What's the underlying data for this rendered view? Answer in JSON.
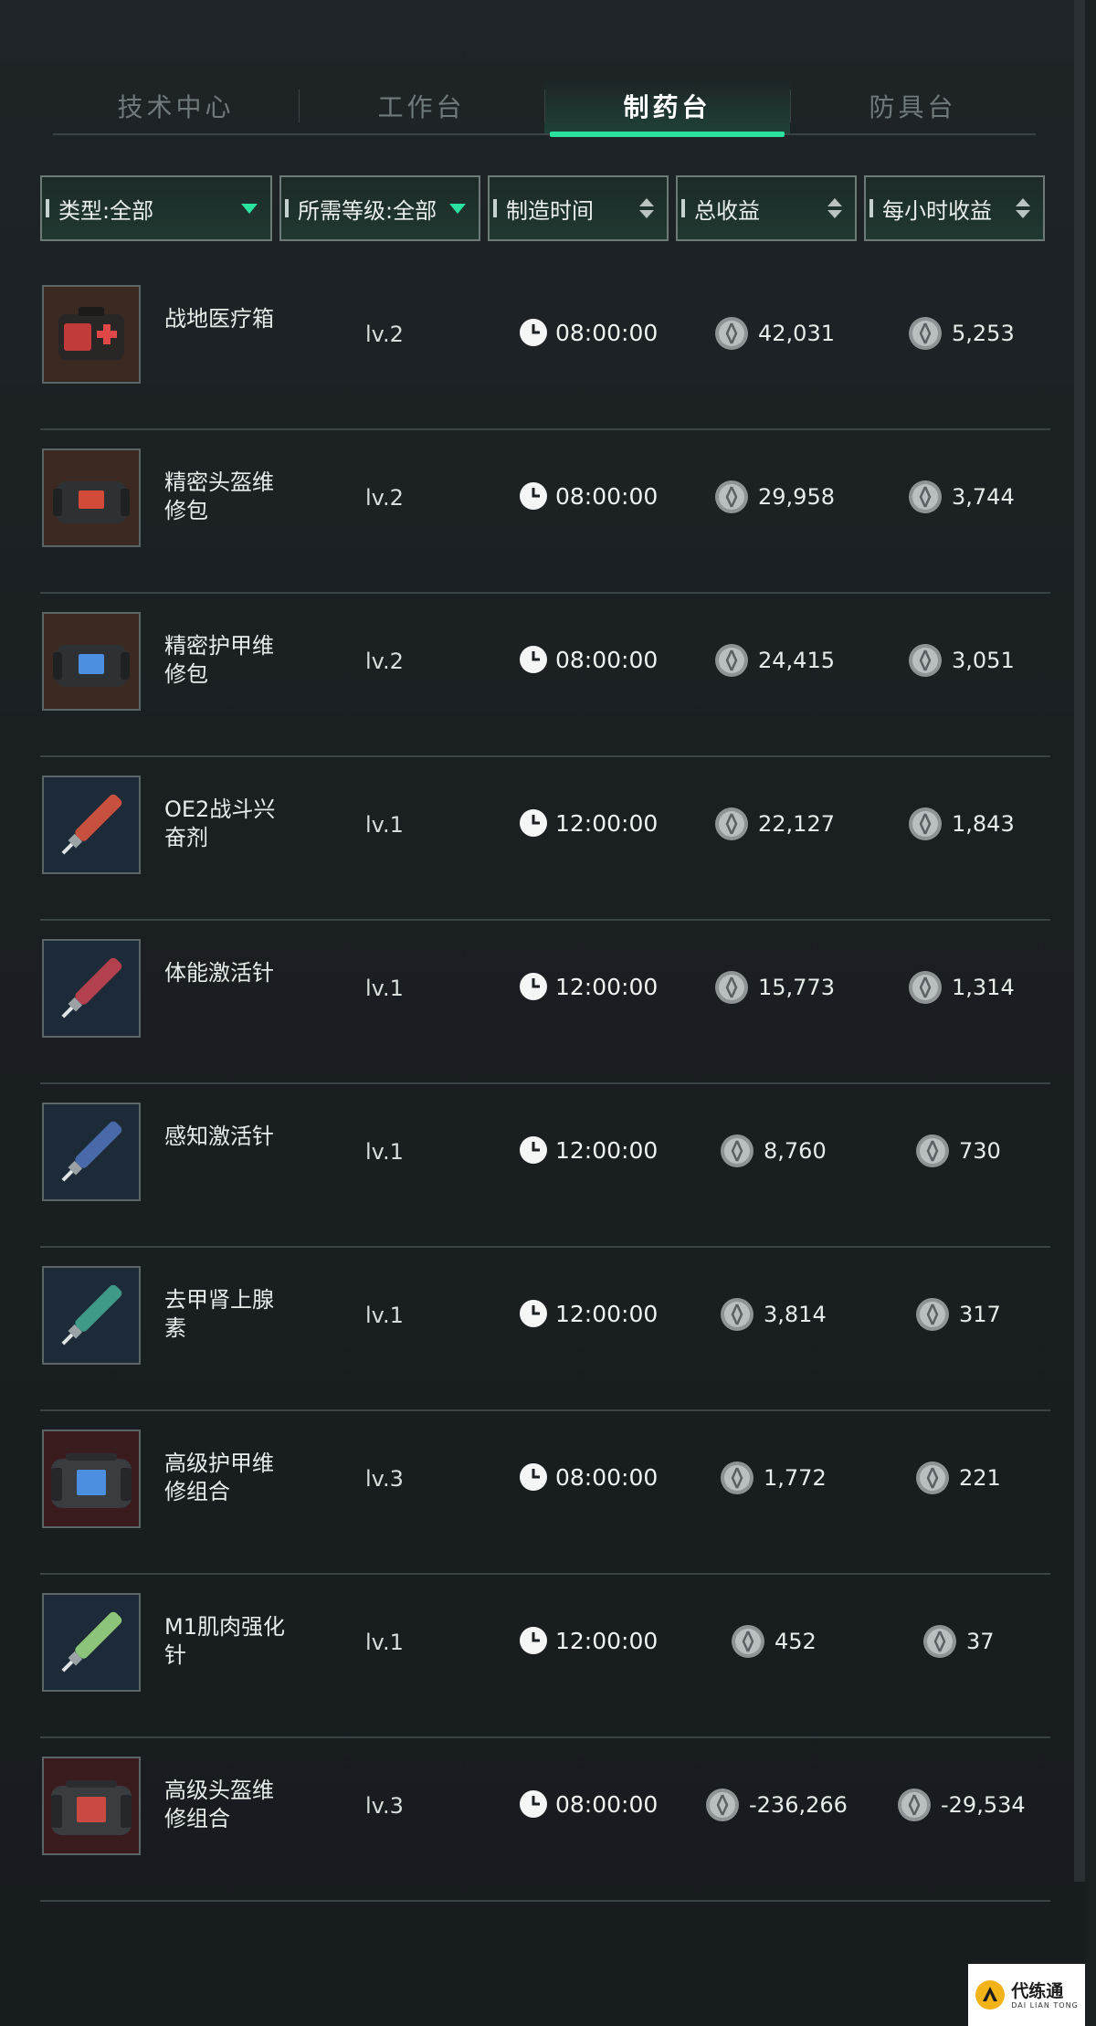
{
  "tabs": [
    {
      "label": "技术中心",
      "active": false
    },
    {
      "label": "工作台",
      "active": false
    },
    {
      "label": "制药台",
      "active": true
    },
    {
      "label": "防具台",
      "active": false
    }
  ],
  "filters": {
    "type": "类型:全部",
    "level": "所需等级:全部",
    "craft_time": "制造时间",
    "total_income": "总收益",
    "hourly_income": "每小时收益"
  },
  "items": [
    {
      "name": "战地医疗箱",
      "level": "lv.2",
      "time": "08:00:00",
      "total": "42,031",
      "hourly": "5,253",
      "icon": "medkit-icon"
    },
    {
      "name": "精密头盔维修包",
      "level": "lv.2",
      "time": "08:00:00",
      "total": "29,958",
      "hourly": "3,744",
      "icon": "repair-kit-icon"
    },
    {
      "name": "精密护甲维修包",
      "level": "lv.2",
      "time": "08:00:00",
      "total": "24,415",
      "hourly": "3,051",
      "icon": "repair-kit-icon"
    },
    {
      "name": "OE2战斗兴奋剂",
      "level": "lv.1",
      "time": "12:00:00",
      "total": "22,127",
      "hourly": "1,843",
      "icon": "injector-icon"
    },
    {
      "name": "体能激活针",
      "level": "lv.1",
      "time": "12:00:00",
      "total": "15,773",
      "hourly": "1,314",
      "icon": "injector-icon"
    },
    {
      "name": "感知激活针",
      "level": "lv.1",
      "time": "12:00:00",
      "total": "8,760",
      "hourly": "730",
      "icon": "injector-icon"
    },
    {
      "name": "去甲肾上腺素",
      "level": "lv.1",
      "time": "12:00:00",
      "total": "3,814",
      "hourly": "317",
      "icon": "injector-icon"
    },
    {
      "name": "高级护甲维修组合",
      "level": "lv.3",
      "time": "08:00:00",
      "total": "1,772",
      "hourly": "221",
      "icon": "repair-combo-icon"
    },
    {
      "name": "M1肌肉强化针",
      "level": "lv.1",
      "time": "12:00:00",
      "total": "452",
      "hourly": "37",
      "icon": "injector-icon"
    },
    {
      "name": "高级头盔维修组合",
      "level": "lv.3",
      "time": "08:00:00",
      "total": "-236,266",
      "hourly": "-29,534",
      "icon": "repair-combo-icon"
    }
  ],
  "colors": {
    "accent": "#2be1a0",
    "injector_colors": [
      "#c8503f",
      "#b3404f",
      "#4a69a8",
      "#3f9a88",
      "#8cc47a"
    ]
  },
  "watermark": {
    "cn": "代练通",
    "en": "DAI LIAN TONG"
  }
}
